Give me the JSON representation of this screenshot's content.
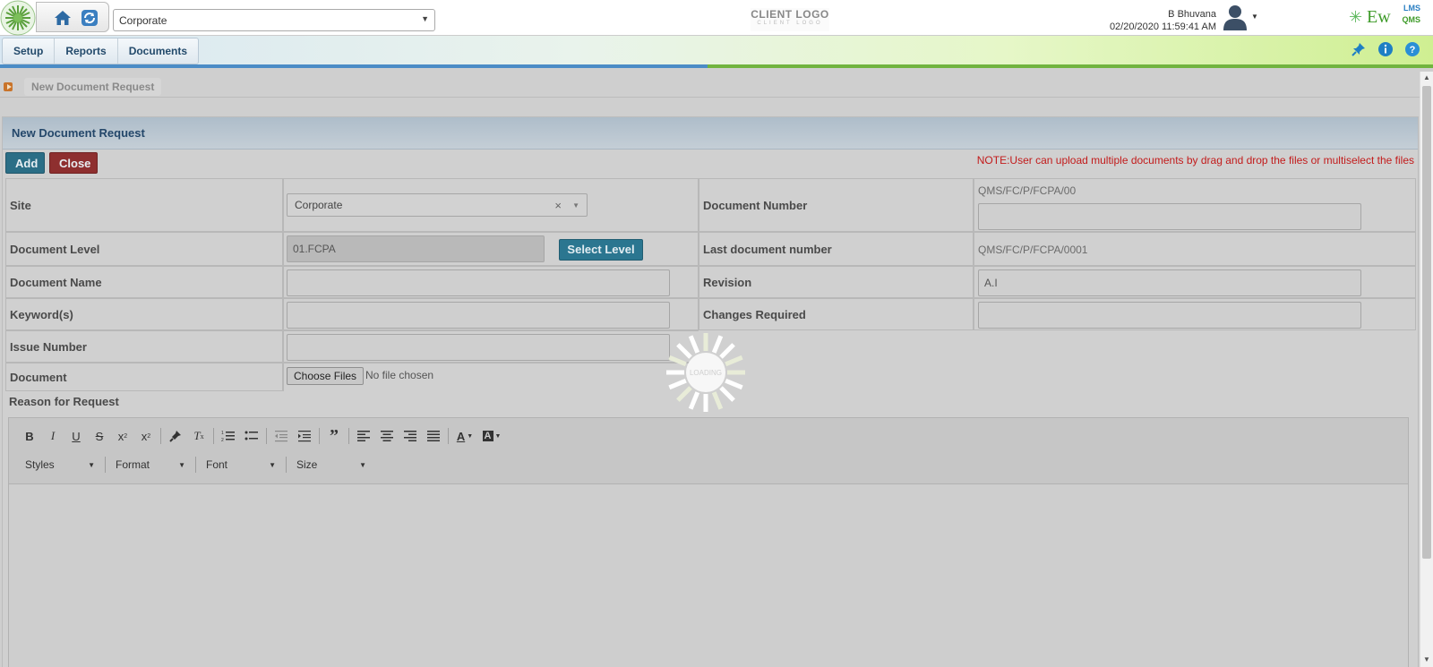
{
  "header": {
    "site_value": "Corporate",
    "client_logo": "CLIENT LOGO",
    "client_logo_sub": "CLIENT LOGO",
    "user_name": "B Bhuvana",
    "datetime": "02/20/2020 11:59:41 AM",
    "brand": "Ew",
    "brand_lms": "LMS",
    "brand_qms": "QMS"
  },
  "nav": {
    "items": [
      {
        "label": "Setup"
      },
      {
        "label": "Reports"
      },
      {
        "label": "Documents"
      }
    ]
  },
  "breadcrumb": {
    "current": "New Document Request"
  },
  "panel": {
    "title": "New Document Request",
    "add_label": "Add",
    "close_label": "Close",
    "note": "NOTE:User can upload multiple documents by drag and drop the files or multiselect the files"
  },
  "form": {
    "site_label": "Site",
    "site_value": "Corporate",
    "site_clear": "×",
    "doc_number_label": "Document Number",
    "doc_number_prefix": "QMS/FC/P/FCPA/00",
    "doc_number_value": "",
    "doc_level_label": "Document Level",
    "doc_level_value": "01.FCPA",
    "select_level_label": "Select Level",
    "last_doc_label": "Last document number",
    "last_doc_value": "QMS/FC/P/FCPA/0001",
    "doc_name_label": "Document Name",
    "doc_name_value": "",
    "revision_label": "Revision",
    "revision_value": "A.I",
    "keywords_label": "Keyword(s)",
    "keywords_value": "",
    "changes_label": "Changes Required",
    "changes_value": "",
    "issue_label": "Issue Number",
    "issue_value": "",
    "document_label": "Document",
    "choose_files_label": "Choose Files",
    "no_file_label": "No file chosen",
    "reason_label": "Reason for Request"
  },
  "editor": {
    "styles_label": "Styles",
    "format_label": "Format",
    "font_label": "Font",
    "size_label": "Size"
  },
  "loading_label": "LOADING",
  "colors": {
    "accent_blue": "#2b7690",
    "close_red": "#8e2f2f",
    "note_red": "#c21b1b",
    "brand_green": "#3f9b2a"
  }
}
